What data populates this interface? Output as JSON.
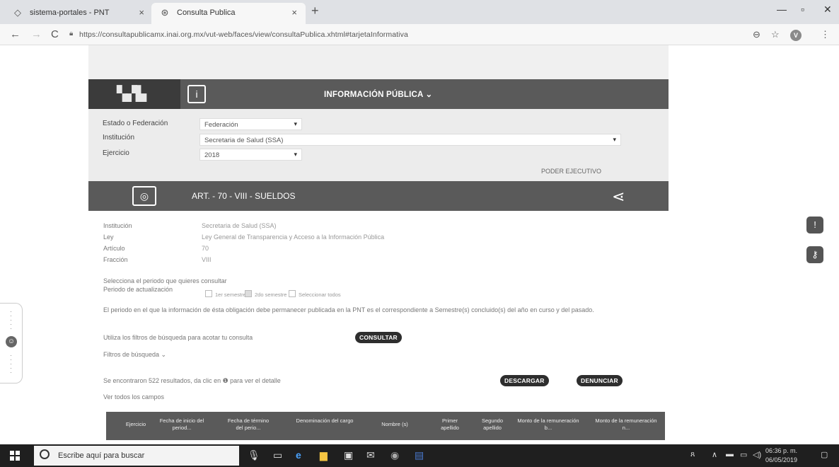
{
  "browser": {
    "tabs": [
      {
        "title": "sistema-portales - PNT",
        "icon": "diamond-icon"
      },
      {
        "title": "Consulta Publica",
        "icon": "globe-icon"
      }
    ],
    "url": "https://consultapublicamx.inai.org.mx/vut-web/faces/view/consultaPublica.xhtml#tarjetaInformativa",
    "profile_initial": "V"
  },
  "header": {
    "info_publica": "INFORMACIÓN PÚBLICA ⌄"
  },
  "form": {
    "estado_label": "Estado o Federación",
    "estado_value": "Federación",
    "institucion_label": "Institución",
    "institucion_value": "Secretaria de Salud (SSA)",
    "ejercicio_label": "Ejercicio",
    "ejercicio_value": "2018",
    "poder": "PODER EJECUTIVO"
  },
  "article": {
    "title": "ART. - 70 - VIII - SUELDOS"
  },
  "details": {
    "institucion_label": "Institución",
    "institucion_value": "Secretaria de Salud (SSA)",
    "ley_label": "Ley",
    "ley_value": "Ley General de Transparencia y Acceso a la Información Pública",
    "articulo_label": "Artículo",
    "articulo_value": "70",
    "fraccion_label": "Fracción",
    "fraccion_value": "VIII"
  },
  "period": {
    "prompt": "Selecciona el periodo que quieres consultar",
    "label": "Periodo de actualización",
    "opt1": "1er semestre",
    "opt2": "2do semestre",
    "opt3": "Seleccionar todos",
    "note": "El periodo en el que la información de ésta obligación debe permanecer publicada en la PNT es el correspondiente a Semestre(s) concluido(s) del año en curso y del pasado.",
    "filters_hint": "Utiliza los filtros de búsqueda para acotar tu consulta",
    "consultar": "CONSULTAR",
    "filtros": "Filtros de búsqueda ⌄"
  },
  "results": {
    "text": "Se encontraron 522 resultados, da clic en ❶ para ver el detalle",
    "descargar": "DESCARGAR",
    "denunciar": "DENUNCIAR",
    "ver_todos": "Ver todos los campos"
  },
  "table": {
    "headers": [
      "Ejercicio",
      "Fecha de inicio del period...",
      "Fecha de término del perio...",
      "Denominación del cargo",
      "Nombre (s)",
      "Primer apellido",
      "Segundo apellido",
      "Monto de la remuneración b...",
      "Monto de la remuneración n..."
    ]
  },
  "taskbar": {
    "search_placeholder": "Escribe aquí para buscar",
    "time": "06:36 p. m.",
    "date": "06/05/2019"
  }
}
